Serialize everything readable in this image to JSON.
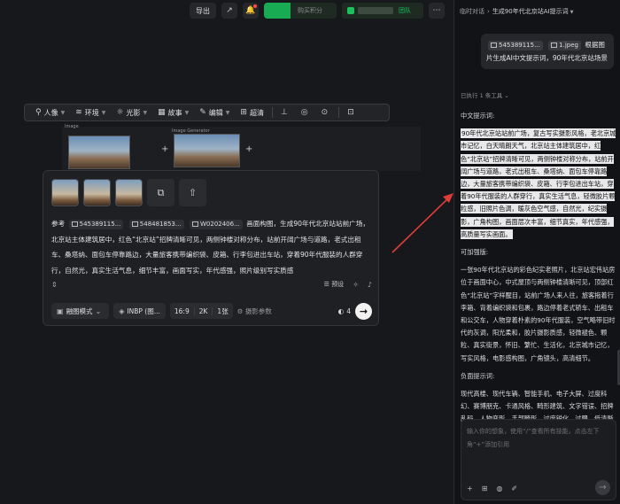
{
  "header": {
    "export_label": "导出",
    "credits_placeholder": "购买积分",
    "team_label": "团队",
    "more_label": "⋯"
  },
  "toolbar": {
    "items": [
      {
        "label": "人像",
        "icon": "person-icon"
      },
      {
        "label": "环境",
        "icon": "landscape-icon"
      },
      {
        "label": "光影",
        "icon": "sun-icon"
      },
      {
        "label": "故事",
        "icon": "film-icon"
      },
      {
        "label": "编辑",
        "icon": "edit-icon"
      },
      {
        "label": "超清",
        "icon": "hd-icon"
      }
    ]
  },
  "canvas": {
    "node_label_left": "Image",
    "node_label_right": "Image Generator"
  },
  "prompt_panel": {
    "refs_label": "参考",
    "ref_chips": [
      "545389115...",
      "548481853...",
      "W0202406..."
    ],
    "prompt_tail": "画面构图，生成90年代北京站站前广场，北京站主体建筑居中，红色“北京站”招牌清晰可见，两侧钟楼对称分布，站前开阔广场与道路，老式出租车、桑塔纳、面包车停靠路边，大量旅客携带编织袋、皮箱、行李包进出车站，穿着90年代服装的人群穿行，自然光，真实生活气息，细节丰富，画面写实，年代感强，照片级别写实质感",
    "preset_label": "预设",
    "mode_label": "融图模式",
    "model_label": "INBP (图...",
    "ratio": "16:9",
    "resolution": "2K",
    "count": "1张",
    "camera_label": "摄影参数",
    "credits": "4"
  },
  "chat": {
    "breadcrumb_root": "临时对话",
    "breadcrumb_current": "生成90年代北京站AI提示词",
    "user_message": {
      "chips": [
        "545389115...",
        "1.jpeg"
      ],
      "text": "根据图片生成AI中文提示词，90年代北京站场景"
    },
    "executed_label": "已执行 1 条工具",
    "sections": [
      {
        "heading": "中文提示词:",
        "body": "90年代北京站站前广场，复古写实摄影风格，老北京城市记忆，白天晴朗天气，北京站主体建筑居中，红色“北京站”招牌清晰可见，两侧钟楼对称分布，站前开阔广场与道路，老式出租车、桑塔纳、面包车停靠路边，大量旅客携带编织袋、皮箱、行李包进出车站，穿着90年代服装的人群穿行，真实生活气息，轻微胶片颗粒感，旧照片色调，暖灰色空气感，自然光，纪实摄影，广角构图，画面层次丰富，细节真实，年代感强，高质量写实画面。"
      },
      {
        "heading": "可加强版:",
        "body": "一张90年代北京站的彩色纪实老照片，北京站宏伟站房位于画面中心，中式屋顶与两侧钟楼清晰可见，顶部红色“北京站”字样醒目，站前广场人来人往，旅客拖着行李箱、背着编织袋和包裹，路边停着老式轿车、出租车和公交车，人物穿着朴素的90年代服装，空气略带旧时代的灰调，阳光柔和，胶片摄影质感，轻微褪色、颗粒、真实街景，怀旧、繁忙、生活化，北京城市记忆，写实风格，电影感构图，广角镜头，高清细节。"
      },
      {
        "heading": "负面提示词:",
        "body": "现代高楼、现代车辆、智能手机、电子大屏、过度科幻、赛博朋克、卡通风格、畸形建筑、文字错误、招牌乱码、人物变形、手部畸形、过度锐化、过曝、低清晰度、虚假透视、杂乱构图。"
      }
    ],
    "input_placeholder": "输入你的想象，使用“/”查看所有技能，点击左下角“+”添加引用"
  },
  "colors": {
    "accent_green": "#18c25d",
    "arrow_red": "#e23b3b",
    "panel_bg": "#1f2023"
  }
}
